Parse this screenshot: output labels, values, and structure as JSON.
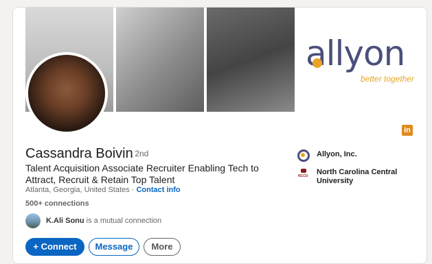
{
  "profile": {
    "name": "Cassandra Boivin",
    "degree": "· 2nd",
    "headline": "Talent Acquisition Associate Recruiter Enabling Tech to Attract, Recruit & Retain Top Talent",
    "location": "Atlanta, Georgia, United States ·",
    "contact_label": "Contact info",
    "connections": "500+ connections",
    "mutual_name": "K.Ali Sonu",
    "mutual_suffix": " is a mutual connection"
  },
  "banner": {
    "logo_word": "allyon",
    "logo_tagline": "better together",
    "linkedin_badge": "in"
  },
  "actions": {
    "connect_label": "+ Connect",
    "message_label": "Message",
    "more_label": "More"
  },
  "organizations": [
    {
      "name": "Allyon, Inc."
    },
    {
      "name": "North Carolina Central University",
      "icon_text": "NCCU"
    }
  ],
  "colors": {
    "primary": "#0a66c2",
    "allyon_navy": "#4a4f7a",
    "allyon_orange": "#e8a524"
  }
}
